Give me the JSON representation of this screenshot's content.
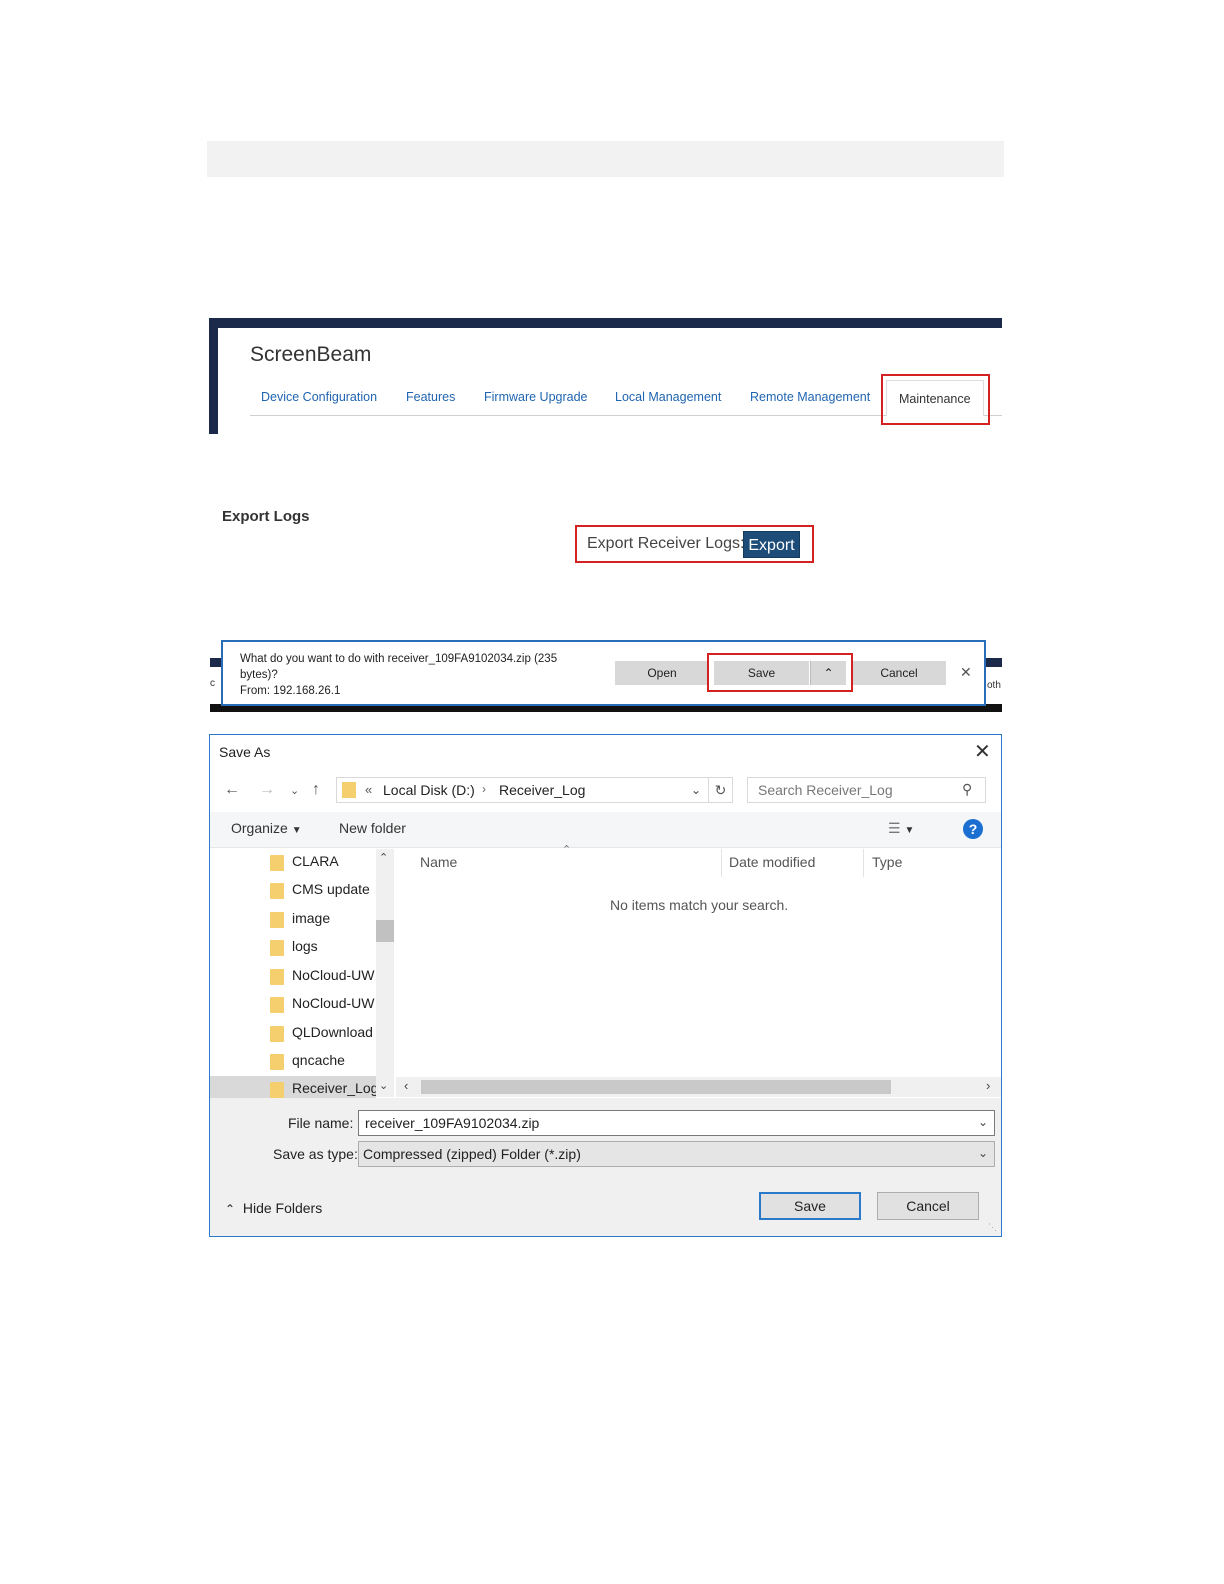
{
  "screenbeam": {
    "title": "ScreenBeam",
    "tabs": [
      "Device Configuration",
      "Features",
      "Firmware Upgrade",
      "Local Management",
      "Remote Management",
      "Maintenance"
    ]
  },
  "export": {
    "heading": "Export Logs",
    "label": "Export Receiver Logs:",
    "button": "Export"
  },
  "download_bar": {
    "message_line1": "What do you want to do with receiver_109FA9102034.zip (235",
    "message_line2": "bytes)?",
    "message_line3": "From: 192.168.26.1",
    "open": "Open",
    "save": "Save",
    "cancel": "Cancel",
    "edge_left": "c",
    "edge_right": "oth"
  },
  "save_as": {
    "title": "Save As",
    "breadcrumb": {
      "prefix": "«",
      "disk": "Local Disk (D:)",
      "folder": "Receiver_Log"
    },
    "search_placeholder": "Search Receiver_Log",
    "organize": "Organize",
    "new_folder": "New folder",
    "tree": [
      "CLARA",
      "CMS update",
      "image",
      "logs",
      "NoCloud-UW",
      "NoCloud-UW",
      "QLDownload",
      "qncache",
      "Receiver_Log"
    ],
    "columns": [
      "Name",
      "Date modified",
      "Type"
    ],
    "empty_message": "No items match your search.",
    "file_name_label": "File name:",
    "file_name": "receiver_109FA9102034.zip",
    "save_type_label": "Save as type:",
    "save_type": "Compressed (zipped) Folder (*.zip)",
    "hide_folders": "Hide Folders",
    "save": "Save",
    "cancel": "Cancel"
  },
  "colors": {
    "link": "#1f64b0",
    "highlight": "#d42222",
    "navy": "#1b2a4a",
    "export_button": "#1d4c78",
    "dialog_border": "#2b79c9"
  }
}
